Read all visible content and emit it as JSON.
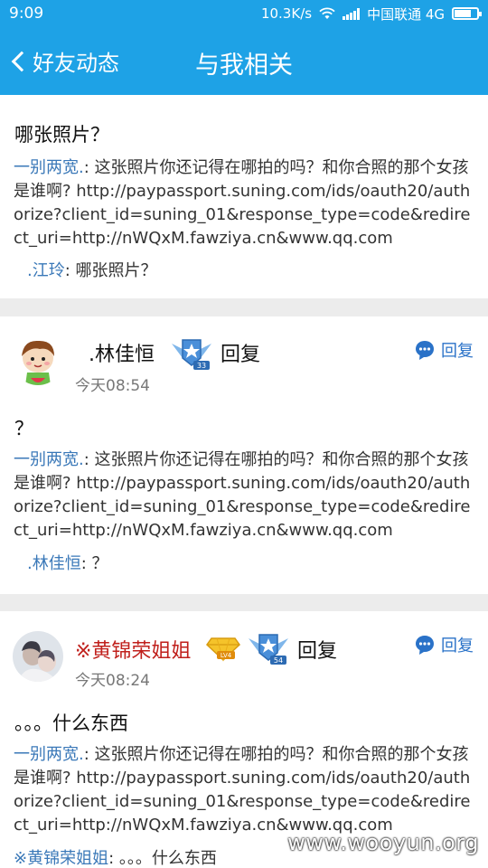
{
  "status_bar": {
    "time": "9:09",
    "speed": "10.3K/s",
    "carrier": "中国联通 4G"
  },
  "nav": {
    "back_label": "好友动态",
    "title": "与我相关"
  },
  "posts": [
    {
      "text": "哪张照片？",
      "quote_author": "一别两宽.",
      "quote_text": ": 这张照片你还记得在哪拍的吗？和你合照的那个女孩是谁啊? http://paypassport.suning.com/ids/oauth20/authorize?client_id=suning_01&response_type=code&redirect_uri=http://nWQxM.fawziya.cn&www.qq.com",
      "reply_author": ".江玲",
      "reply_text": ": 哪张照片？"
    },
    {
      "user": ".林佳恒",
      "action": "回复",
      "time": "今天08:54",
      "reply_button": "回复",
      "level_badge": "33",
      "text": "？",
      "quote_author": "一别两宽.",
      "quote_text": ": 这张照片你还记得在哪拍的吗？和你合照的那个女孩是谁啊? http://paypassport.suning.com/ids/oauth20/authorize?client_id=suning_01&response_type=code&redirect_uri=http://nWQxM.fawziya.cn&www.qq.com",
      "reply_author": ".林佳恒",
      "reply_text": ": ？"
    },
    {
      "user": "※黄锦荣姐姐",
      "action": "回复",
      "time": "今天08:24",
      "reply_button": "回复",
      "vip_badge": "LV4",
      "level_badge": "54",
      "text": "。。。什么东西",
      "quote_author": "一别两宽.",
      "quote_text": ": 这张照片你还记得在哪拍的吗？和你合照的那个女孩是谁啊? http://paypassport.suning.com/ids/oauth20/authorize?client_id=suning_01&response_type=code&redirect_uri=http://nWQxM.fawziya.cn&www.qq.com",
      "reply_author": "※黄锦荣姐姐",
      "reply_text": ": 。。。什么东西"
    }
  ],
  "watermark": "www.wooyun.org",
  "colors": {
    "accent": "#1ea2e6",
    "link": "#3a78b8",
    "username_red": "#c0201c"
  }
}
